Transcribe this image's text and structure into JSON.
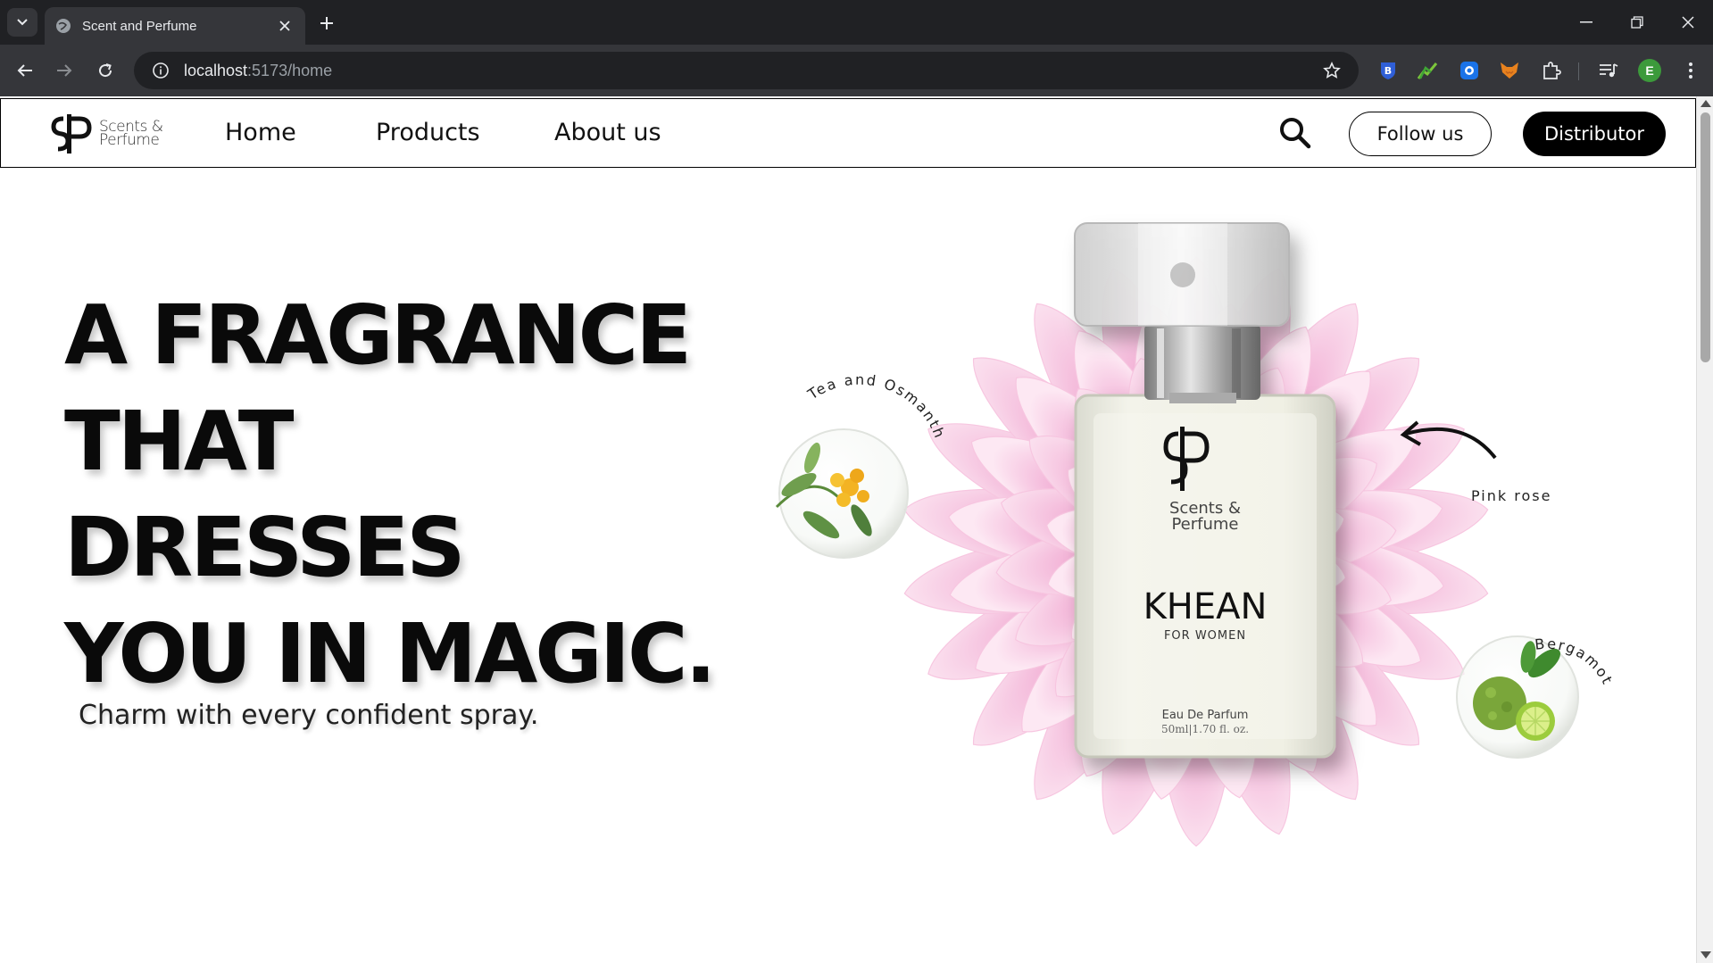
{
  "browser": {
    "tab_title": "Scent and Perfume",
    "url_host": "localhost",
    "url_path": ":5173/home",
    "profile_initial": "E"
  },
  "site": {
    "logo_text_line1": "Scents &",
    "logo_text_line2": "Perfume",
    "nav": [
      "Home",
      "Products",
      "About us"
    ],
    "follow_label": "Follow us",
    "distributor_label": "Distributor"
  },
  "hero": {
    "headline_lines": [
      "A FRAGRANCE",
      "THAT",
      "DRESSES",
      "YOU IN MAGIC."
    ],
    "subline": "Charm with every confident spray.",
    "bottle": {
      "brand_line1": "Scents &",
      "brand_line2": "Perfume",
      "name": "KHEAN",
      "sub": "FOR WOMEN",
      "type": "Eau De Parfum",
      "volume": "50ml|1.70 fl. oz."
    },
    "notes": {
      "top_left": "Tea and Osmanthus",
      "right": "Pink rose",
      "bottom_right": "Bergamot"
    }
  },
  "colors": {
    "petal": "#f3a9d3",
    "petal_dark": "#e07bb6",
    "accent_black": "#000000"
  }
}
